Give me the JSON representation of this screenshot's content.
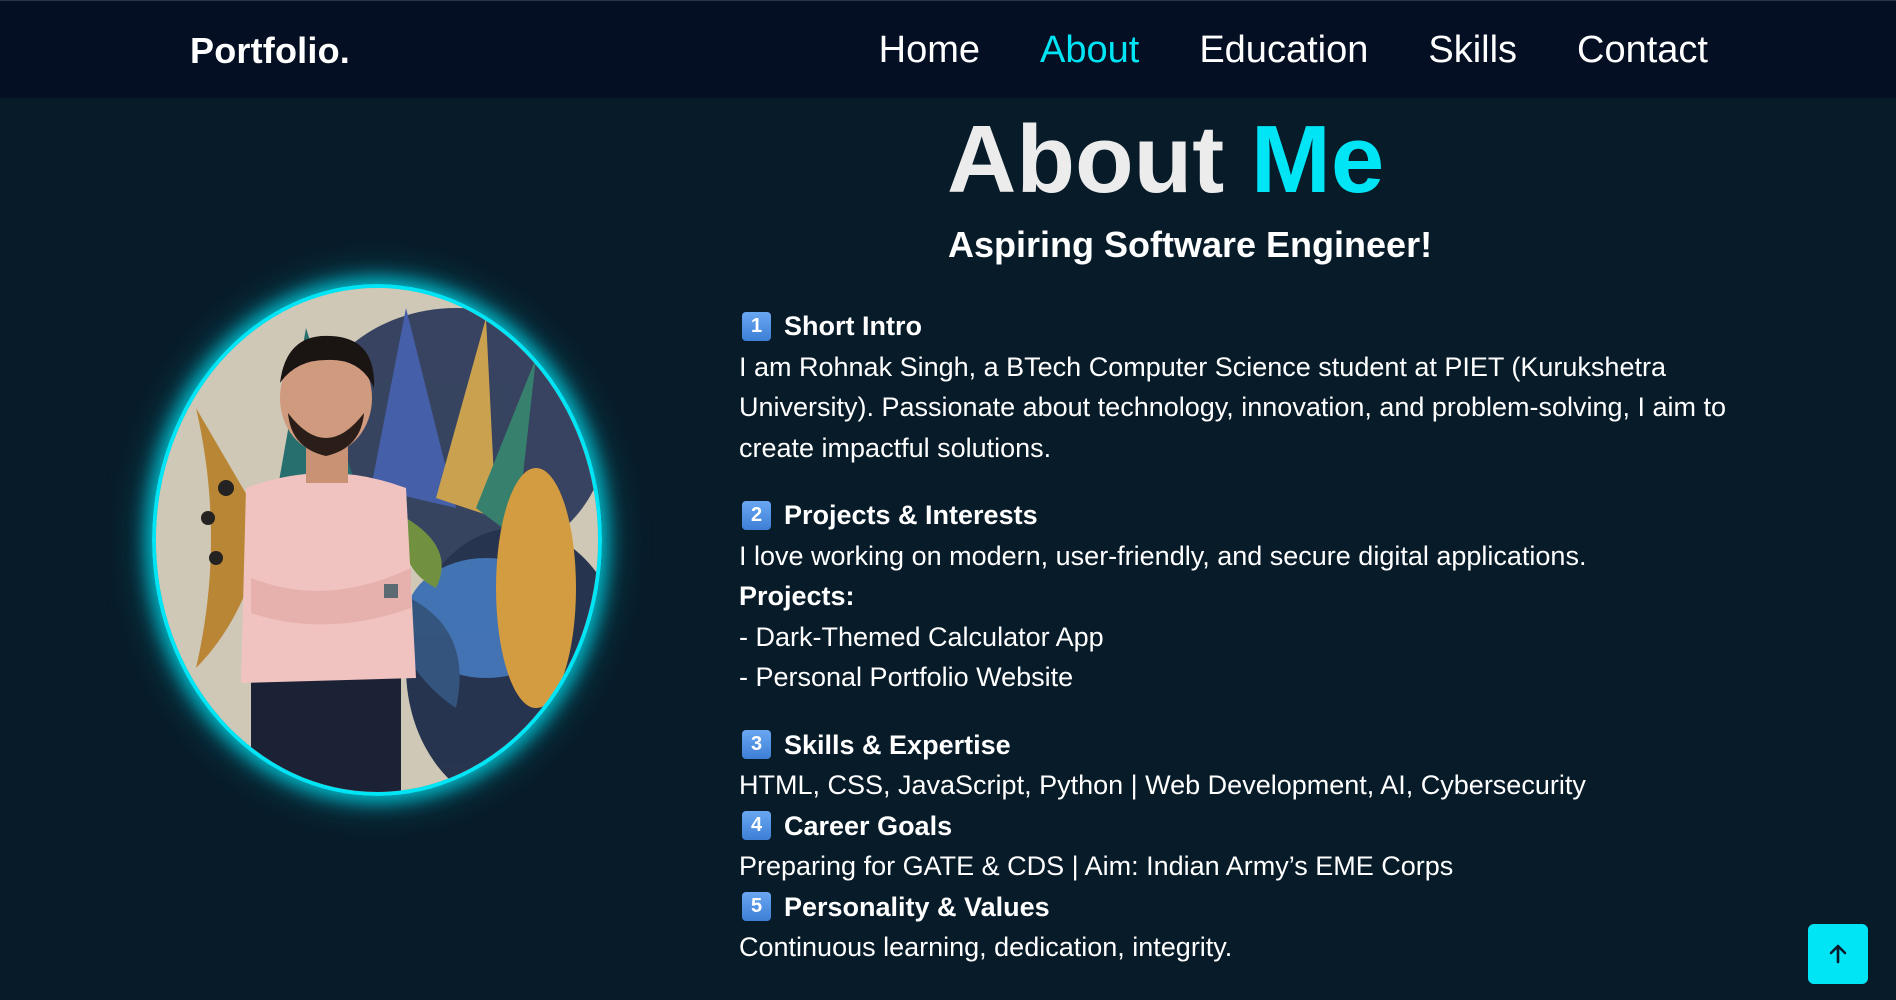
{
  "header": {
    "logo": "Portfolio.",
    "nav": [
      {
        "label": "Home"
      },
      {
        "label": "About"
      },
      {
        "label": "Education"
      },
      {
        "label": "Skills"
      },
      {
        "label": "Contact"
      }
    ]
  },
  "about": {
    "title_main": "About",
    "title_accent": "Me",
    "subtitle": "Aspiring Software Engineer!",
    "sections": [
      {
        "number": "1",
        "heading": "Short Intro",
        "text": "I am Rohnak Singh, a BTech Computer Science student at PIET (Kurukshetra University). Passionate about technology, innovation, and problem-solving, I aim to create impactful solutions."
      },
      {
        "number": "2",
        "heading": "Projects & Interests",
        "text": "I love working on modern, user-friendly, and secure digital applications.",
        "projects_label": "Projects:",
        "projects": [
          "- Dark-Themed Calculator App",
          "- Personal Portfolio Website"
        ]
      },
      {
        "number": "3",
        "heading": "Skills & Expertise",
        "text": "HTML, CSS, JavaScript, Python | Web Development, AI, Cybersecurity"
      },
      {
        "number": "4",
        "heading": "Career Goals",
        "text": "Preparing for GATE & CDS | Aim: Indian Army’s EME Corps"
      },
      {
        "number": "5",
        "heading": "Personality & Values",
        "text": "Continuous learning, dedication, integrity."
      }
    ]
  },
  "icons": {
    "scroll_top": "arrow-up-icon",
    "number_badges": "keycap-number-icon"
  },
  "colors": {
    "accent": "#00e5f5",
    "background": "#081b29",
    "header_bg": "#050f23",
    "badge": "#4a8fe3"
  }
}
